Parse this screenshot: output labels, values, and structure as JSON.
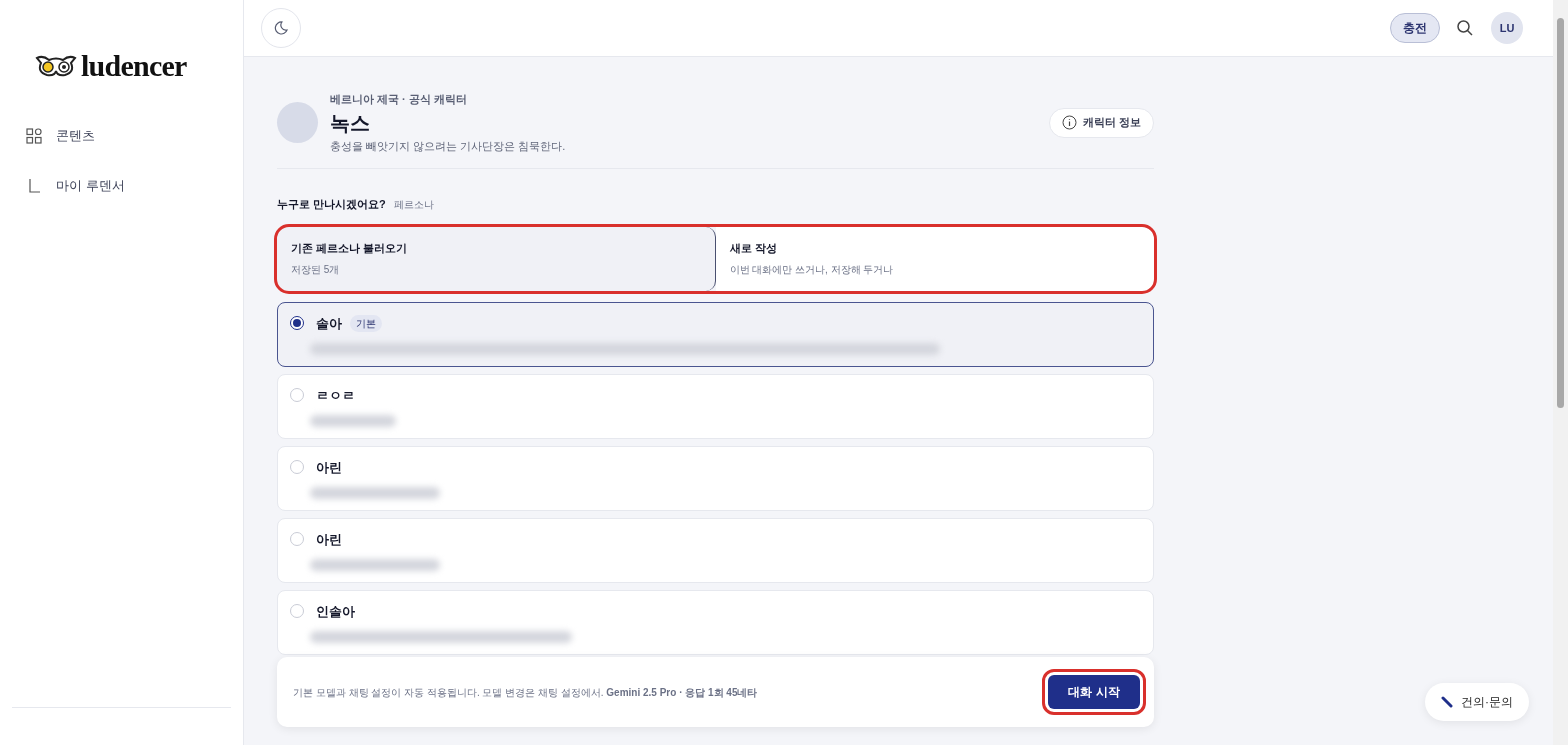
{
  "sidebar": {
    "logo": "ludencer",
    "items": [
      {
        "label": "콘텐츠",
        "selected": false
      },
      {
        "label": "마이 루덴서",
        "selected": false
      }
    ]
  },
  "topbar": {
    "charge_button": "충전",
    "avatar": "LU"
  },
  "character": {
    "subtitle": "베르니아 제국 · 공식 캐릭터",
    "name": "녹스",
    "tagline": "충성을 빼앗기지 않으려는 기사단장은 침묵한다.",
    "info_button": "캐릭터 정보"
  },
  "persona_section": {
    "question": "누구로 만나시겠어요?",
    "hint": "페르소나",
    "highlighted": true,
    "segments": [
      {
        "title": "기존 페르소나 불러오기",
        "subtitle": "저장된 5개",
        "selected": true
      },
      {
        "title": "새로 작성",
        "subtitle": "이번 대화에만 쓰거나, 저장해 두거나",
        "selected": false
      }
    ],
    "personas": [
      {
        "name": "솔아",
        "badge": "기본",
        "selected": true
      },
      {
        "name": "ㄹㅇㄹ",
        "selected": false
      },
      {
        "name": "아린",
        "selected": false
      },
      {
        "name": "아린",
        "selected": false
      },
      {
        "name": "인솔아",
        "selected": false
      }
    ]
  },
  "footer_bar": {
    "note": "기본 모델과 채팅 설정이 자동 적용됩니다. 모델 변경은 채팅 설정에서. **Gemini 2.5 Pro · 응답 1회 45네타**",
    "start_button": "대화 시작",
    "highlighted": true
  },
  "feedback_button": "건의·문의"
}
